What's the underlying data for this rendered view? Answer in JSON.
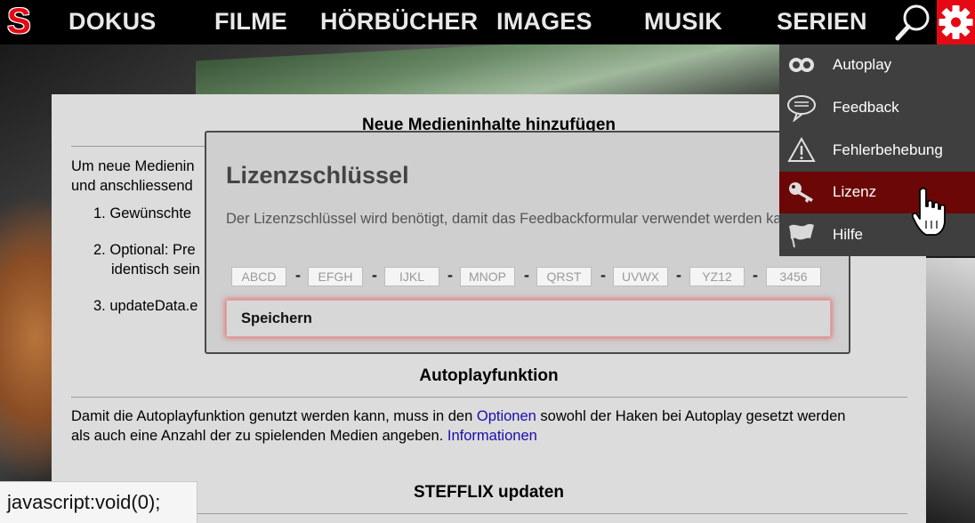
{
  "app": {
    "logo": "S",
    "accent": "#e50914"
  },
  "nav": {
    "items": [
      "DOKUS",
      "FILME",
      "HÖRBÜCHER",
      "IMAGES",
      "MUSIK",
      "SERIEN"
    ],
    "search_icon": "search-icon",
    "settings_icon": "gear-icon"
  },
  "page": {
    "section1_title": "Neue Medieninhalte hinzufügen",
    "section1_intro_line1": "Um neue Medienin",
    "section1_intro_line2": "und anschliessend",
    "steps": [
      {
        "num": "1.",
        "text": "Gewünschte"
      },
      {
        "num": "2.",
        "text": "Optional: Pre",
        "text2": "identisch sein"
      },
      {
        "num": "3.",
        "text": "updateData.e"
      }
    ],
    "section2_title": "Autoplayfunktion",
    "section2_text_a": "Damit die Autoplayfunktion genutzt werden kann, muss in den ",
    "section2_link_options": "Optionen",
    "section2_text_b": " sowohl der Haken bei Autoplay gesetzt werden",
    "section2_text_c": "als auch eine Anzahl der zu spielenden Medien angeben. ",
    "section2_link_info": "Informationen",
    "section3_title": "STEFFLIX updaten"
  },
  "modal": {
    "title": "Lizenzschlüssel",
    "description": "Der Lizenzschlüssel wird benötigt, damit das Feedbackformular verwendet werden kann.",
    "fields": [
      {
        "placeholder": "ABCD"
      },
      {
        "placeholder": "EFGH"
      },
      {
        "placeholder": "IJKL"
      },
      {
        "placeholder": "MNOP"
      },
      {
        "placeholder": "QRST"
      },
      {
        "placeholder": "UVWX"
      },
      {
        "placeholder": "YZ12"
      },
      {
        "placeholder": "3456"
      }
    ],
    "separator": "-",
    "save_label": "Speichern"
  },
  "menu": {
    "items": [
      {
        "label": "Autoplay",
        "icon": "infinity-icon"
      },
      {
        "label": "Feedback",
        "icon": "speech-bubble-icon"
      },
      {
        "label": "Fehlerbehebung",
        "icon": "warning-icon"
      },
      {
        "label": "Lizenz",
        "icon": "key-icon",
        "active": true
      },
      {
        "label": "Hilfe",
        "icon": "flag-icon"
      }
    ],
    "active_color": "#6b0707"
  },
  "status": {
    "text": "javascript:void(0);"
  }
}
